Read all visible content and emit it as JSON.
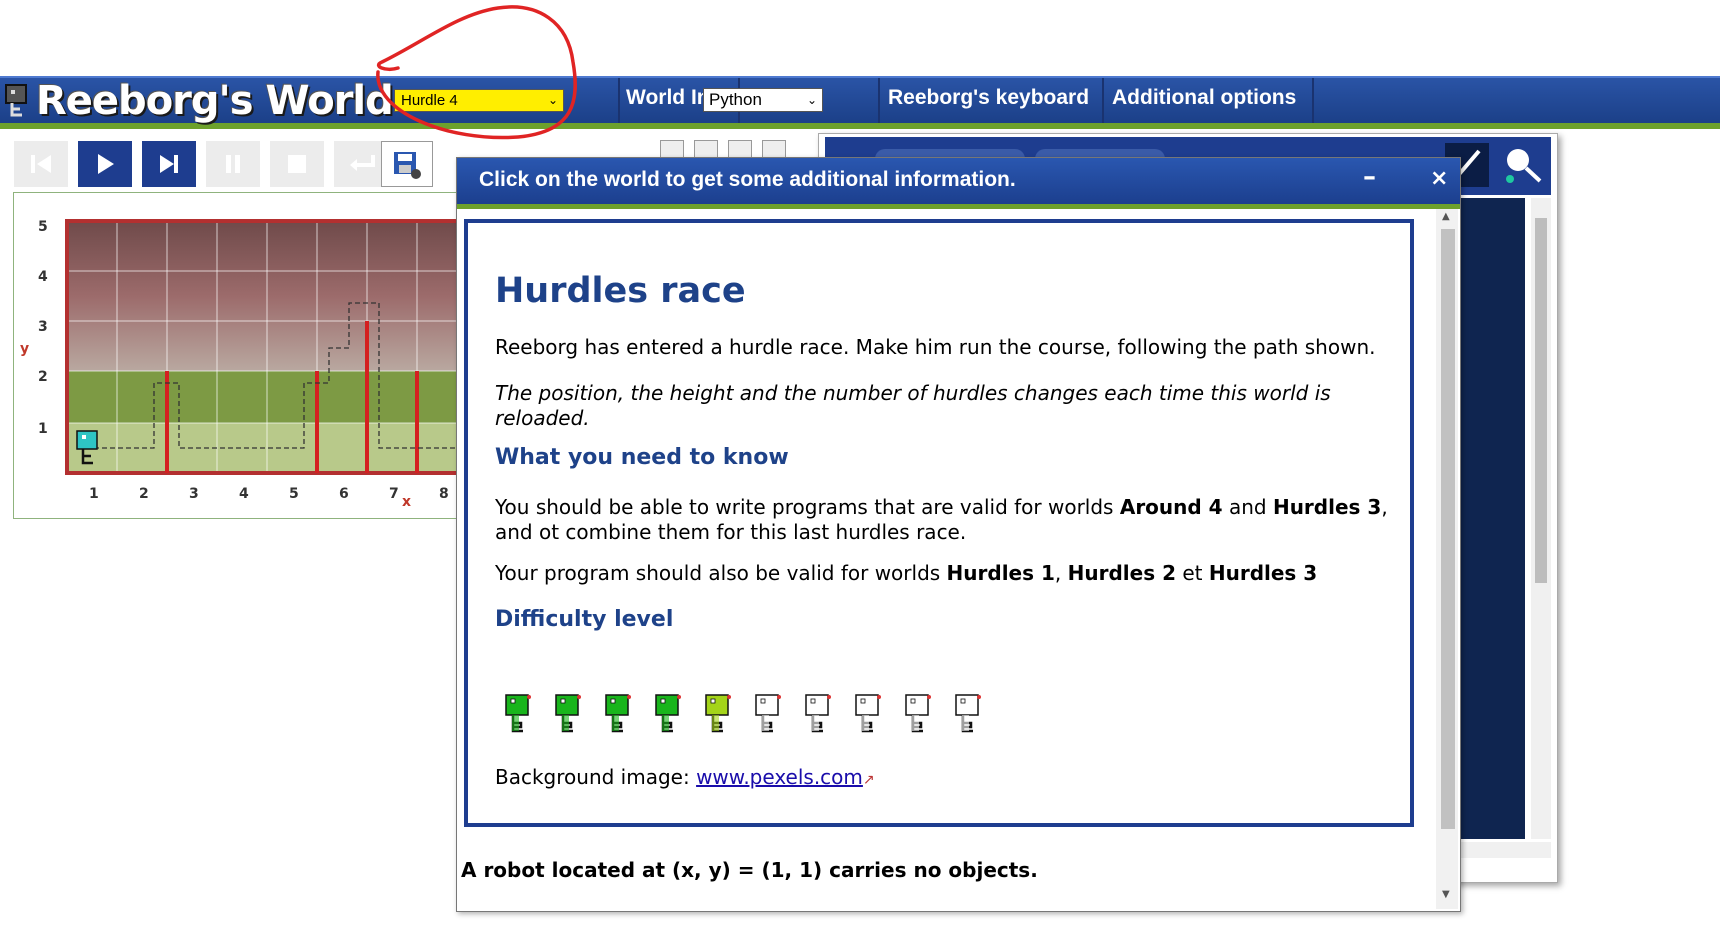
{
  "header": {
    "app_title": "Reeborg's World",
    "world_selected": "Hurdle 4",
    "world_info_label": "World Info",
    "language_selected": "Python",
    "keyboard_label": "Reeborg's keyboard",
    "options_label": "Additional options",
    "colors": {
      "bar": "#1e3d8f",
      "accent_line": "#6da12c",
      "world_select_bg": "#ffee00"
    }
  },
  "toolbar": {
    "buttons": [
      {
        "name": "reload-button",
        "icon": "skip-back-icon",
        "enabled": false
      },
      {
        "name": "run-button",
        "icon": "play-icon",
        "enabled": true
      },
      {
        "name": "step-button",
        "icon": "step-forward-icon",
        "enabled": true
      },
      {
        "name": "pause-button",
        "icon": "pause-icon",
        "enabled": false
      },
      {
        "name": "stop-button",
        "icon": "stop-icon",
        "enabled": false
      },
      {
        "name": "back-button",
        "icon": "return-icon",
        "enabled": false
      },
      {
        "name": "save-button",
        "icon": "save-icon",
        "enabled": true
      }
    ]
  },
  "world": {
    "y_axis_label": "y",
    "x_axis_label": "x",
    "y_ticks": [
      "5",
      "4",
      "3",
      "2",
      "1"
    ],
    "x_ticks": [
      "1",
      "2",
      "3",
      "4",
      "5",
      "6",
      "7",
      "8"
    ],
    "robot_position": {
      "x": 1,
      "y": 1
    }
  },
  "dialog": {
    "title": "Click on the world to get some additional information.",
    "minimize_label": "–",
    "close_label": "×",
    "heading": "Hurdles race",
    "intro": "Reeborg has entered a hurdle race. Make him run the course, following the path shown.",
    "note": "The position, the height and the number of hurdles changes each time this world is reloaded.",
    "need_to_know_heading": "What you need to know",
    "need_p1_a": "You should be able to write programs that are valid for worlds ",
    "need_p1_b": "Around 4",
    "need_p1_c": " and ",
    "need_p1_d": "Hurdles 3",
    "need_p1_e": ", and ot combine them for this last hurdles race.",
    "need_p2_a": "Your program should also be valid for worlds ",
    "need_p2_b": "Hurdles 1",
    "need_p2_c": ", ",
    "need_p2_d": "Hurdles 2",
    "need_p2_e": " et ",
    "need_p2_f": "Hurdles 3",
    "difficulty_heading": "Difficulty level",
    "difficulty": {
      "level": 5,
      "max": 10
    },
    "background_prefix": "Background image: ",
    "background_link": "www.pexels.com",
    "status": "A robot located at (x, y) = (1, 1) carries no objects."
  }
}
